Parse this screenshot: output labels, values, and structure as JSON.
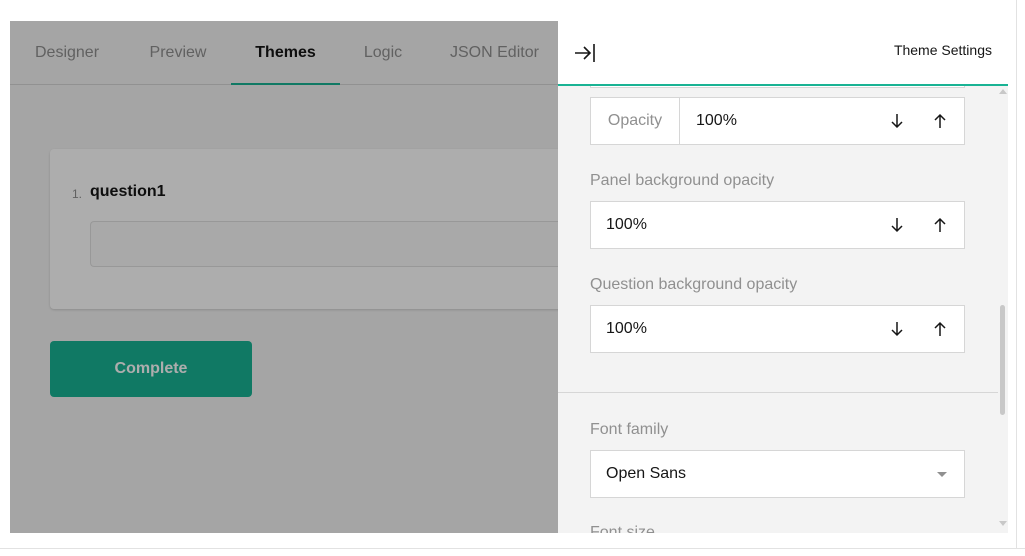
{
  "tabs": [
    {
      "label": "Designer",
      "active": false
    },
    {
      "label": "Preview",
      "active": false
    },
    {
      "label": "Themes",
      "active": true
    },
    {
      "label": "Logic",
      "active": false
    },
    {
      "label": "JSON Editor",
      "active": false
    }
  ],
  "survey": {
    "question_number": "1.",
    "question_title": "question1",
    "complete_label": "Complete"
  },
  "settings": {
    "title": "Theme Settings",
    "collapse_icon": "arrow-right-to-bar-icon",
    "opacity": {
      "prefix": "Opacity",
      "value": "100%"
    },
    "panel_background_opacity": {
      "label": "Panel background opacity",
      "value": "100%"
    },
    "question_background_opacity": {
      "label": "Question background opacity",
      "value": "100%"
    },
    "font_family": {
      "label": "Font family",
      "value": "Open Sans"
    },
    "font_size": {
      "label": "Font size"
    }
  },
  "colors": {
    "accent": "#19b394",
    "panel_bg": "#f3f3f3",
    "border": "#d6d6d6",
    "muted_text": "#909090",
    "text": "#161616"
  }
}
